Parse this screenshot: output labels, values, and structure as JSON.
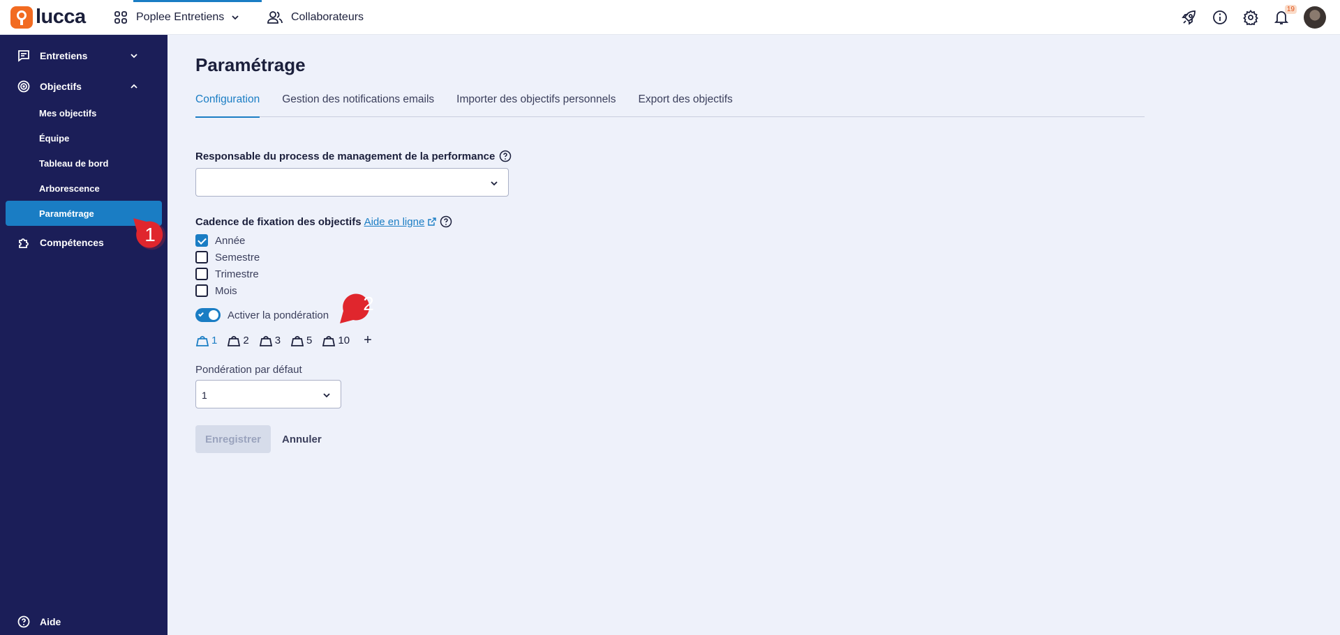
{
  "topbar": {
    "logo_text": "lucca",
    "apps_label": "Poplee Entretiens",
    "collab_label": "Collaborateurs",
    "notif_count": "19"
  },
  "sidebar": {
    "entretiens": "Entretiens",
    "objectifs": "Objectifs",
    "sub": [
      "Mes objectifs",
      "Équipe",
      "Tableau de bord",
      "Arborescence",
      "Paramétrage"
    ],
    "competences": "Compétences",
    "help": "Aide"
  },
  "markers": {
    "one": "1",
    "two": "2"
  },
  "main": {
    "title": "Paramétrage",
    "tabs": [
      "Configuration",
      "Gestion des notifications emails",
      "Importer des objectifs personnels",
      "Export des objectifs"
    ],
    "responsable_label": "Responsable du process de management de la performance",
    "responsable_value": "",
    "cadence_label": "Cadence de fixation des objectifs",
    "help_link": "Aide en ligne",
    "cadences": [
      "Année",
      "Semestre",
      "Trimestre",
      "Mois"
    ],
    "cadence_checked": [
      true,
      false,
      false,
      false
    ],
    "toggle_label": "Activer la pondération",
    "toggle_on": true,
    "weights": [
      "1",
      "2",
      "3",
      "5",
      "10"
    ],
    "add_weight": "+",
    "default_weight_label": "Pondération par défaut",
    "default_weight_value": "1",
    "save": "Enregistrer",
    "cancel": "Annuler"
  },
  "colors": {
    "accent": "#1a7dc4",
    "sidebar": "#1b1e58",
    "marker": "#e0262d",
    "brand": "#f26b21"
  }
}
